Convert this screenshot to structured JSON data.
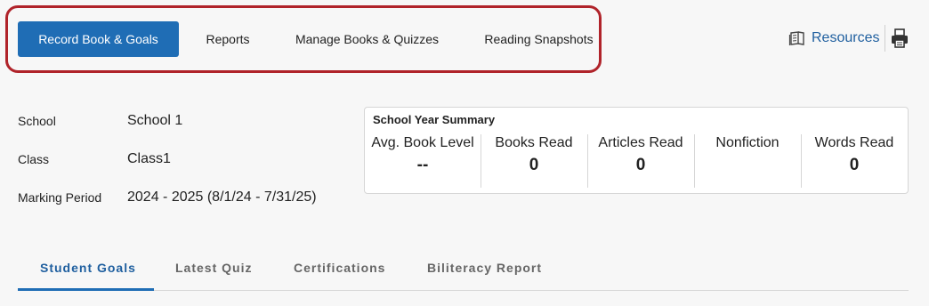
{
  "nav": {
    "tabs": [
      {
        "label": "Record Book & Goals",
        "active": true
      },
      {
        "label": "Reports",
        "active": false
      },
      {
        "label": "Manage Books & Quizzes",
        "active": false
      },
      {
        "label": "Reading Snapshots",
        "active": false
      }
    ],
    "highlight_color": "#b0232a",
    "active_color": "#1f6db5"
  },
  "header": {
    "resources_label": "Resources",
    "resources_icon": "book-icon",
    "print_icon": "printer-icon"
  },
  "info": {
    "school_label": "School",
    "school_value": "School 1",
    "class_label": "Class",
    "class_value": "Class1",
    "marking_label": "Marking Period",
    "marking_value": "2024 - 2025 (8/1/24 - 7/31/25)"
  },
  "summary": {
    "title": "School Year Summary",
    "stats": [
      {
        "label": "Avg. Book Level",
        "value": "--"
      },
      {
        "label": "Books Read",
        "value": "0"
      },
      {
        "label": "Articles Read",
        "value": "0"
      },
      {
        "label": "Nonfiction",
        "value": ""
      },
      {
        "label": "Words Read",
        "value": "0"
      }
    ]
  },
  "subtabs": [
    {
      "label": "Student Goals",
      "active": true
    },
    {
      "label": "Latest Quiz",
      "active": false
    },
    {
      "label": "Certifications",
      "active": false
    },
    {
      "label": "Biliteracy Report",
      "active": false
    }
  ]
}
